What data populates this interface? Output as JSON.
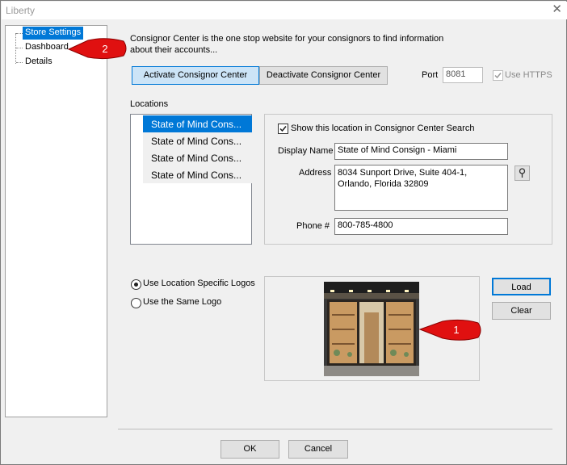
{
  "window": {
    "title": "Liberty"
  },
  "tree": {
    "items": [
      {
        "label": "Store Settings"
      },
      {
        "label": "Dashboard"
      },
      {
        "label": "Details"
      }
    ]
  },
  "intro": {
    "text": "Consignor Center is the one stop website for your consignors to find information about their accounts..."
  },
  "buttons": {
    "activate": "Activate Consignor Center",
    "deactivate": "Deactivate Consignor Center",
    "load": "Load",
    "clear": "Clear",
    "ok": "OK",
    "cancel": "Cancel"
  },
  "port": {
    "label": "Port",
    "value": "8081"
  },
  "https": {
    "label": "Use HTTPS",
    "checked": true,
    "enabled": false
  },
  "locations": {
    "label": "Locations",
    "items": [
      "State of Mind Cons...",
      "State of Mind Cons...",
      "State of Mind Cons...",
      "State of Mind Cons..."
    ],
    "selected_index": 0
  },
  "detail": {
    "show_label": "Show this location in Consignor Center Search",
    "show_checked": true,
    "display_name_label": "Display Name",
    "display_name": "State of Mind Consign - Miami",
    "address_label": "Address",
    "address_line1": "8034 Sunport Drive, Suite 404-1,",
    "address_line2": "Orlando, Florida  32809",
    "phone_label": "Phone #",
    "phone": "800-785-4800"
  },
  "logo_options": {
    "specific": "Use Location Specific Logos",
    "same": "Use the Same Logo",
    "selected": "specific"
  },
  "callouts": {
    "one": "1",
    "two": "2"
  },
  "colors": {
    "selection": "#0078d7",
    "callout": "#e01010"
  }
}
